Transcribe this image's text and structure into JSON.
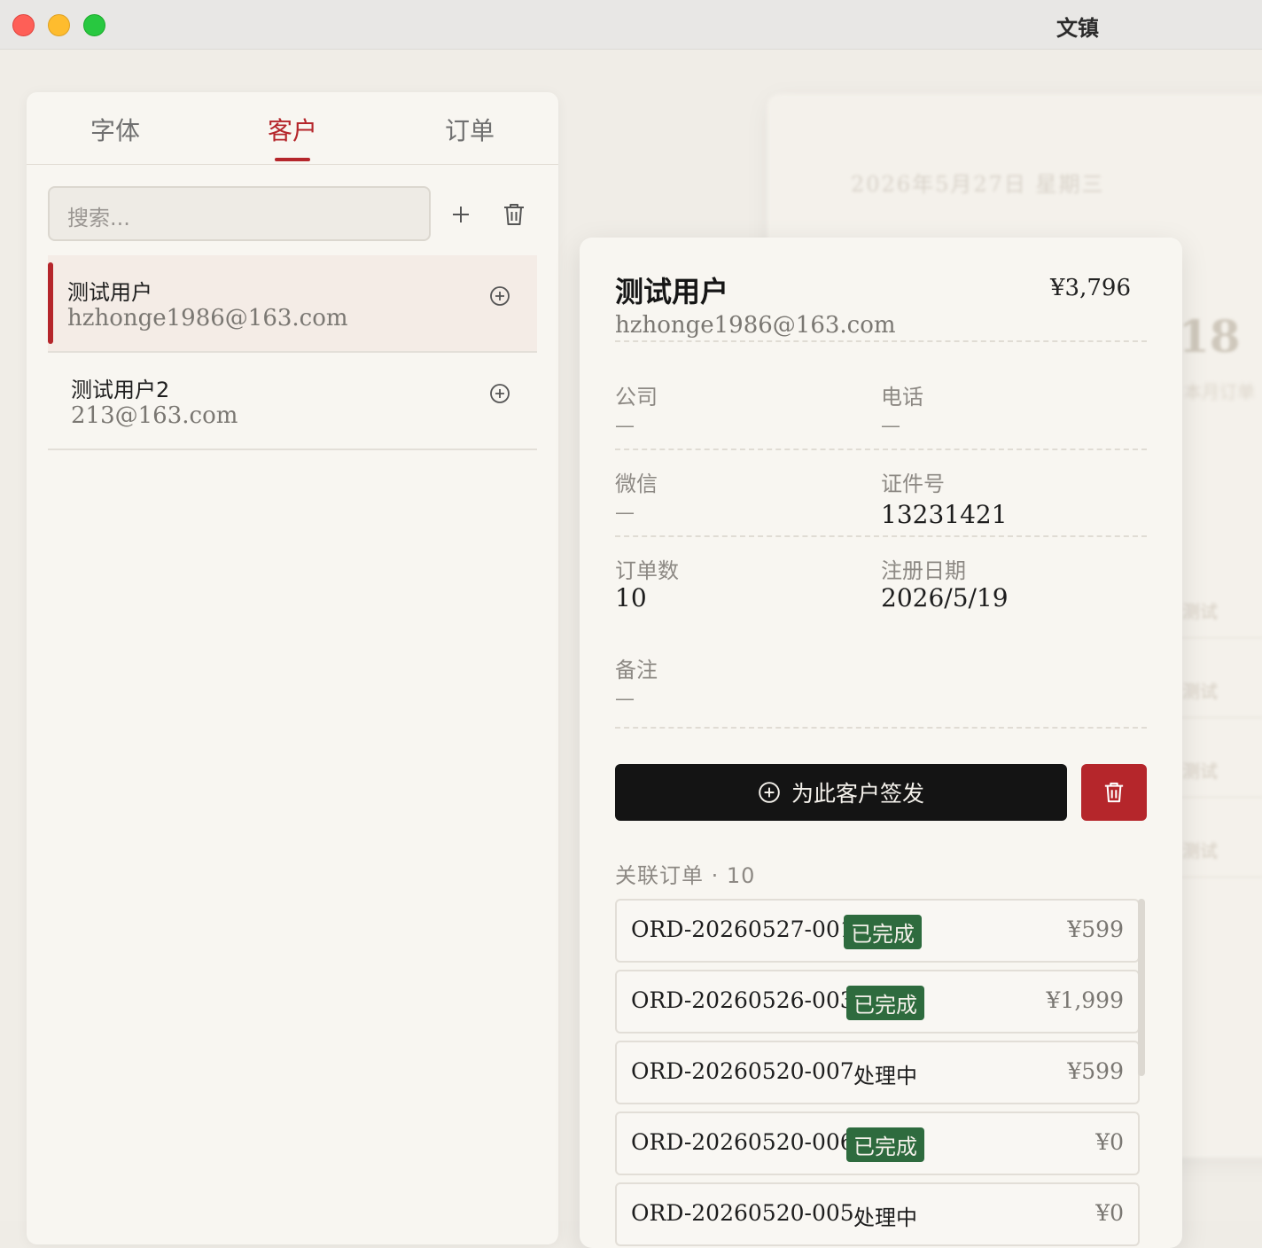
{
  "window": {
    "title": "文镇"
  },
  "background": {
    "date": "2026年5月27日 星期三",
    "big_number": "18",
    "sub": "本月订单",
    "row_text": "测试"
  },
  "sidebar": {
    "tabs": [
      {
        "label": "字体"
      },
      {
        "label": "客户"
      },
      {
        "label": "订单"
      }
    ],
    "active_tab": "客户",
    "search": {
      "placeholder": "搜索..."
    },
    "customers": [
      {
        "name": "测试用户",
        "email": "hzhonge1986@163.com",
        "selected": true
      },
      {
        "name": "测试用户2",
        "email": "213@163.com",
        "selected": false
      }
    ]
  },
  "detail": {
    "name": "测试用户",
    "total": "¥3,796",
    "email": "hzhonge1986@163.com",
    "fields": {
      "company": {
        "label": "公司",
        "value": "—"
      },
      "phone": {
        "label": "电话",
        "value": "—"
      },
      "wechat": {
        "label": "微信",
        "value": "—"
      },
      "id_number": {
        "label": "证件号",
        "value": "13231421"
      },
      "order_count": {
        "label": "订单数",
        "value": "10"
      },
      "register_date": {
        "label": "注册日期",
        "value": "2026/5/19"
      },
      "note": {
        "label": "备注",
        "value": "—"
      }
    },
    "issue_button": "为此客户签发",
    "orders_label": "关联订单 · 10",
    "orders": [
      {
        "id": "ORD-20260527-001",
        "status": "已完成",
        "status_type": "done",
        "amount": "¥599"
      },
      {
        "id": "ORD-20260526-003",
        "status": "已完成",
        "status_type": "done",
        "amount": "¥1,999"
      },
      {
        "id": "ORD-20260520-007",
        "status": "处理中",
        "status_type": "pending",
        "amount": "¥599"
      },
      {
        "id": "ORD-20260520-006",
        "status": "已完成",
        "status_type": "done",
        "amount": "¥0"
      },
      {
        "id": "ORD-20260520-005",
        "status": "处理中",
        "status_type": "pending",
        "amount": "¥0"
      }
    ]
  },
  "colors": {
    "accent": "#b5262b",
    "done_badge": "#2e6b3e",
    "primary_button": "#141414"
  }
}
